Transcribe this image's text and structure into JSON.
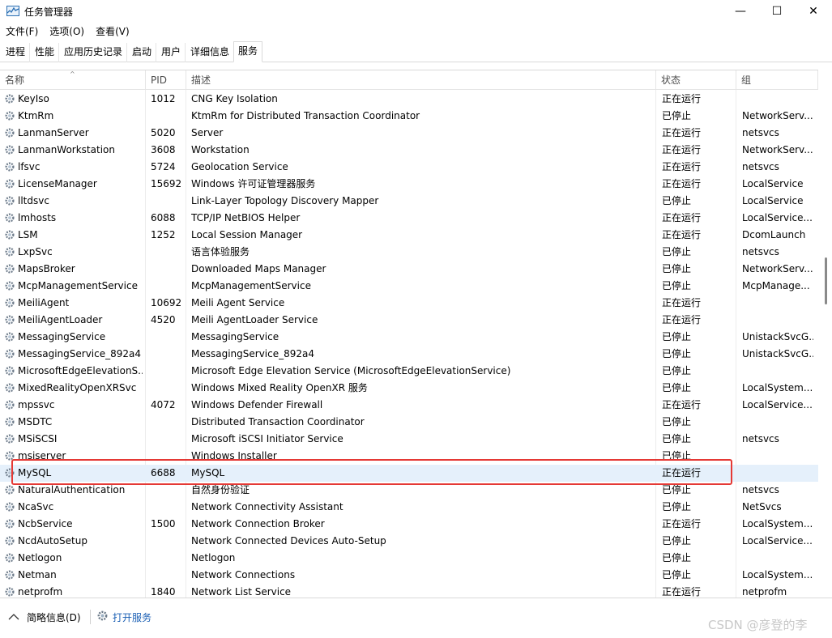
{
  "window": {
    "title": "任务管理器",
    "controls": {
      "minimize": "—",
      "maximize": "☐",
      "close": "✕"
    }
  },
  "menu": [
    "文件(F)",
    "选项(O)",
    "查看(V)"
  ],
  "tabs": [
    {
      "label": "进程",
      "active": false
    },
    {
      "label": "性能",
      "active": false
    },
    {
      "label": "应用历史记录",
      "active": false
    },
    {
      "label": "启动",
      "active": false
    },
    {
      "label": "用户",
      "active": false
    },
    {
      "label": "详细信息",
      "active": false
    },
    {
      "label": "服务",
      "active": true
    }
  ],
  "columns": {
    "name": "名称",
    "pid": "PID",
    "desc": "描述",
    "status": "状态",
    "group": "组",
    "sort_indicator": "^"
  },
  "rows": [
    {
      "name": "KeyIso",
      "pid": "1012",
      "desc": "CNG Key Isolation",
      "status": "正在运行",
      "group": ""
    },
    {
      "name": "KtmRm",
      "pid": "",
      "desc": "KtmRm for Distributed Transaction Coordinator",
      "status": "已停止",
      "group": "NetworkServ..."
    },
    {
      "name": "LanmanServer",
      "pid": "5020",
      "desc": "Server",
      "status": "正在运行",
      "group": "netsvcs"
    },
    {
      "name": "LanmanWorkstation",
      "pid": "3608",
      "desc": "Workstation",
      "status": "正在运行",
      "group": "NetworkServ..."
    },
    {
      "name": "lfsvc",
      "pid": "5724",
      "desc": "Geolocation Service",
      "status": "正在运行",
      "group": "netsvcs"
    },
    {
      "name": "LicenseManager",
      "pid": "15692",
      "desc": "Windows 许可证管理器服务",
      "status": "正在运行",
      "group": "LocalService"
    },
    {
      "name": "lltdsvc",
      "pid": "",
      "desc": "Link-Layer Topology Discovery Mapper",
      "status": "已停止",
      "group": "LocalService"
    },
    {
      "name": "lmhosts",
      "pid": "6088",
      "desc": "TCP/IP NetBIOS Helper",
      "status": "正在运行",
      "group": "LocalService..."
    },
    {
      "name": "LSM",
      "pid": "1252",
      "desc": "Local Session Manager",
      "status": "正在运行",
      "group": "DcomLaunch"
    },
    {
      "name": "LxpSvc",
      "pid": "",
      "desc": "语言体验服务",
      "status": "已停止",
      "group": "netsvcs"
    },
    {
      "name": "MapsBroker",
      "pid": "",
      "desc": "Downloaded Maps Manager",
      "status": "已停止",
      "group": "NetworkServ..."
    },
    {
      "name": "McpManagementService",
      "pid": "",
      "desc": "McpManagementService",
      "status": "已停止",
      "group": "McpManage..."
    },
    {
      "name": "MeiliAgent",
      "pid": "10692",
      "desc": "Meili Agent Service",
      "status": "正在运行",
      "group": ""
    },
    {
      "name": "MeiliAgentLoader",
      "pid": "4520",
      "desc": "Meili AgentLoader Service",
      "status": "正在运行",
      "group": ""
    },
    {
      "name": "MessagingService",
      "pid": "",
      "desc": "MessagingService",
      "status": "已停止",
      "group": "UnistackSvcG..."
    },
    {
      "name": "MessagingService_892a4",
      "pid": "",
      "desc": "MessagingService_892a4",
      "status": "已停止",
      "group": "UnistackSvcG..."
    },
    {
      "name": "MicrosoftEdgeElevationS...",
      "pid": "",
      "desc": "Microsoft Edge Elevation Service (MicrosoftEdgeElevationService)",
      "status": "已停止",
      "group": ""
    },
    {
      "name": "MixedRealityOpenXRSvc",
      "pid": "",
      "desc": "Windows Mixed Reality OpenXR 服务",
      "status": "已停止",
      "group": "LocalSystem..."
    },
    {
      "name": "mpssvc",
      "pid": "4072",
      "desc": "Windows Defender Firewall",
      "status": "正在运行",
      "group": "LocalService..."
    },
    {
      "name": "MSDTC",
      "pid": "",
      "desc": "Distributed Transaction Coordinator",
      "status": "已停止",
      "group": ""
    },
    {
      "name": "MSiSCSI",
      "pid": "",
      "desc": "Microsoft iSCSI Initiator Service",
      "status": "已停止",
      "group": "netsvcs"
    },
    {
      "name": "msiserver",
      "pid": "",
      "desc": "Windows Installer",
      "status": "已停止",
      "group": ""
    },
    {
      "name": "MySQL",
      "pid": "6688",
      "desc": "MySQL",
      "status": "正在运行",
      "group": "",
      "selected": true
    },
    {
      "name": "NaturalAuthentication",
      "pid": "",
      "desc": "自然身份验证",
      "status": "已停止",
      "group": "netsvcs"
    },
    {
      "name": "NcaSvc",
      "pid": "",
      "desc": "Network Connectivity Assistant",
      "status": "已停止",
      "group": "NetSvcs"
    },
    {
      "name": "NcbService",
      "pid": "1500",
      "desc": "Network Connection Broker",
      "status": "正在运行",
      "group": "LocalSystem..."
    },
    {
      "name": "NcdAutoSetup",
      "pid": "",
      "desc": "Network Connected Devices Auto-Setup",
      "status": "已停止",
      "group": "LocalService..."
    },
    {
      "name": "Netlogon",
      "pid": "",
      "desc": "Netlogon",
      "status": "已停止",
      "group": ""
    },
    {
      "name": "Netman",
      "pid": "",
      "desc": "Network Connections",
      "status": "已停止",
      "group": "LocalSystem..."
    },
    {
      "name": "netprofm",
      "pid": "1840",
      "desc": "Network List Service",
      "status": "正在运行",
      "group": "netprofm"
    }
  ],
  "footer": {
    "fewer_details": "简略信息(D)",
    "open_services": "打开服务",
    "watermark": "CSDN @彦登的李"
  },
  "colors": {
    "selected_row": "#e5f0fb",
    "highlight_box": "#e53935",
    "link": "#1a5fb4"
  }
}
